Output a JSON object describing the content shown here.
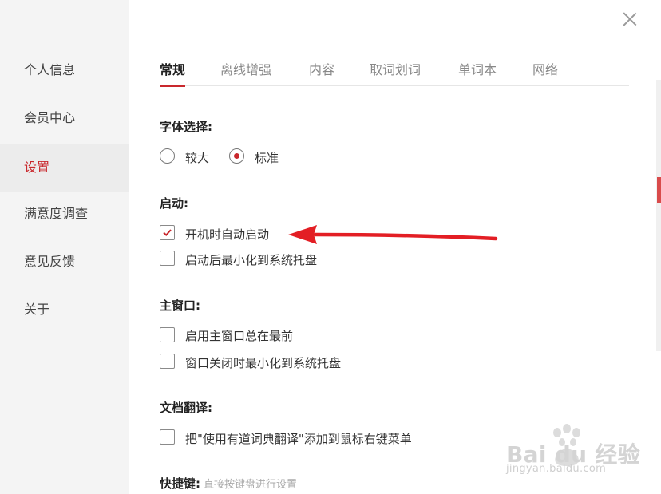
{
  "sidebar": {
    "items": [
      {
        "label": "个人信息"
      },
      {
        "label": "会员中心"
      },
      {
        "label": "设置",
        "active": true
      },
      {
        "label": "满意度调查"
      },
      {
        "label": "意见反馈"
      },
      {
        "label": "关于"
      }
    ]
  },
  "tabs": [
    {
      "label": "常规",
      "active": true
    },
    {
      "label": "离线增强"
    },
    {
      "label": "内容"
    },
    {
      "label": "取词划词"
    },
    {
      "label": "单词本"
    },
    {
      "label": "网络"
    }
  ],
  "font_section": {
    "title": "字体选择:",
    "options": [
      {
        "label": "较大",
        "selected": false
      },
      {
        "label": "标准",
        "selected": true
      }
    ]
  },
  "startup_section": {
    "title": "启动:",
    "options": [
      {
        "label": "开机时自动启动",
        "checked": true
      },
      {
        "label": "启动后最小化到系统托盘",
        "checked": false
      }
    ]
  },
  "main_window_section": {
    "title": "主窗口:",
    "options": [
      {
        "label": "启用主窗口总在最前",
        "checked": false
      },
      {
        "label": "窗口关闭时最小化到系统托盘",
        "checked": false
      }
    ]
  },
  "doc_translate_section": {
    "title": "文档翻译:",
    "options": [
      {
        "label": "把\"使用有道词典翻译\"添加到鼠标右键菜单",
        "checked": false
      }
    ]
  },
  "hotkey_section": {
    "title": "快捷键:",
    "hint": "直接按键盘进行设置"
  },
  "annotation": {
    "arrow_color": "#e31e24"
  },
  "watermark": {
    "logo_text": "Bai du 经验",
    "url_text": "jingyan.baidu.com"
  },
  "colors": {
    "accent": "#c9282d",
    "sidebar_bg": "#f4f4f4",
    "sidebar_active_bg": "#ececec"
  }
}
